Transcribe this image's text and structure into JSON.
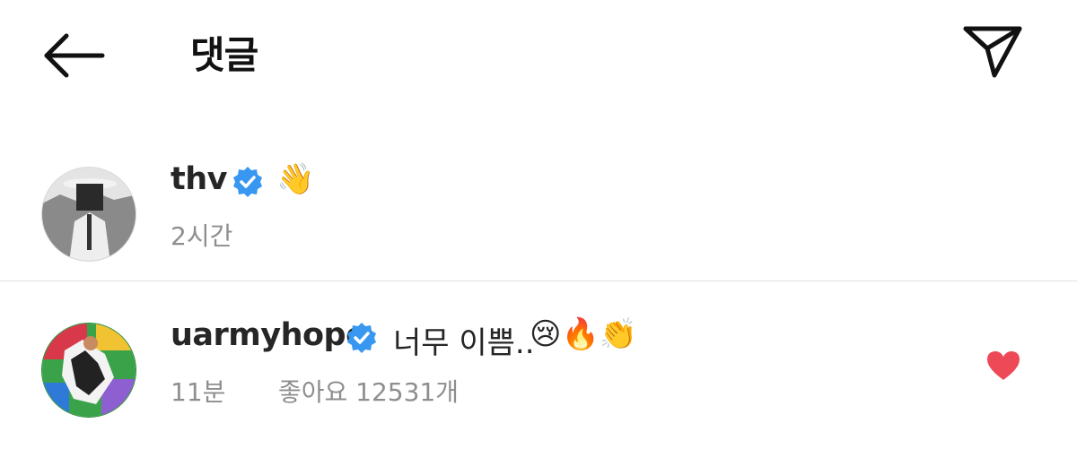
{
  "header": {
    "title": "댓글",
    "back_icon": "arrow-left-icon",
    "send_icon": "paper-plane-icon"
  },
  "caption": {
    "username": "thv",
    "verified": true,
    "emoji": "👋",
    "time": "2시간"
  },
  "comments": [
    {
      "username": "uarmyhope",
      "verified": true,
      "text": "너무 이쁨..",
      "emojis": "😢🔥👏",
      "time": "11분",
      "likes": "좋아요 12531개",
      "liked": true
    }
  ],
  "colors": {
    "verified_blue": "#3897f0",
    "heart_red": "#ed4956",
    "meta_gray": "#8e8e8e"
  }
}
